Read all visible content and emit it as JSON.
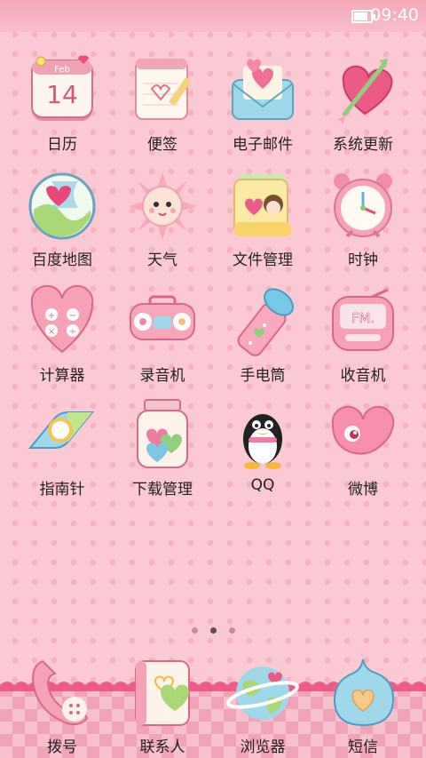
{
  "status_bar": {
    "time": "09:40",
    "battery_level": 0.85
  },
  "apps": [
    {
      "id": "calendar",
      "label": "日历",
      "icon": "calendar-icon",
      "date_month": "Feb",
      "date_day": "14"
    },
    {
      "id": "notes",
      "label": "便签",
      "icon": "notepad-icon"
    },
    {
      "id": "email",
      "label": "电子邮件",
      "icon": "envelope-icon"
    },
    {
      "id": "update",
      "label": "系统更新",
      "icon": "heart-arrow-icon"
    },
    {
      "id": "map",
      "label": "百度地图",
      "icon": "map-pin-icon"
    },
    {
      "id": "weather",
      "label": "天气",
      "icon": "sun-icon"
    },
    {
      "id": "files",
      "label": "文件管理",
      "icon": "folder-icon"
    },
    {
      "id": "clock",
      "label": "时钟",
      "icon": "alarm-clock-icon"
    },
    {
      "id": "calculator",
      "label": "计算器",
      "icon": "calculator-icon"
    },
    {
      "id": "recorder",
      "label": "录音机",
      "icon": "cassette-player-icon"
    },
    {
      "id": "flashlight",
      "label": "手电筒",
      "icon": "flashlight-icon"
    },
    {
      "id": "radio",
      "label": "收音机",
      "icon": "radio-icon",
      "radio_text": "FM."
    },
    {
      "id": "compass",
      "label": "指南针",
      "icon": "compass-icon"
    },
    {
      "id": "downloads",
      "label": "下载管理",
      "icon": "jar-icon"
    },
    {
      "id": "qq",
      "label": "QQ",
      "icon": "penguin-icon"
    },
    {
      "id": "weibo",
      "label": "微博",
      "icon": "weibo-eye-icon"
    }
  ],
  "page_indicator": {
    "count": 3,
    "active": 2
  },
  "dock": [
    {
      "id": "dialer",
      "label": "拨号",
      "icon": "phone-icon"
    },
    {
      "id": "contacts",
      "label": "联系人",
      "icon": "contacts-book-icon"
    },
    {
      "id": "browser",
      "label": "浏览器",
      "icon": "globe-icon"
    },
    {
      "id": "sms",
      "label": "短信",
      "icon": "message-bubble-icon"
    }
  ]
}
